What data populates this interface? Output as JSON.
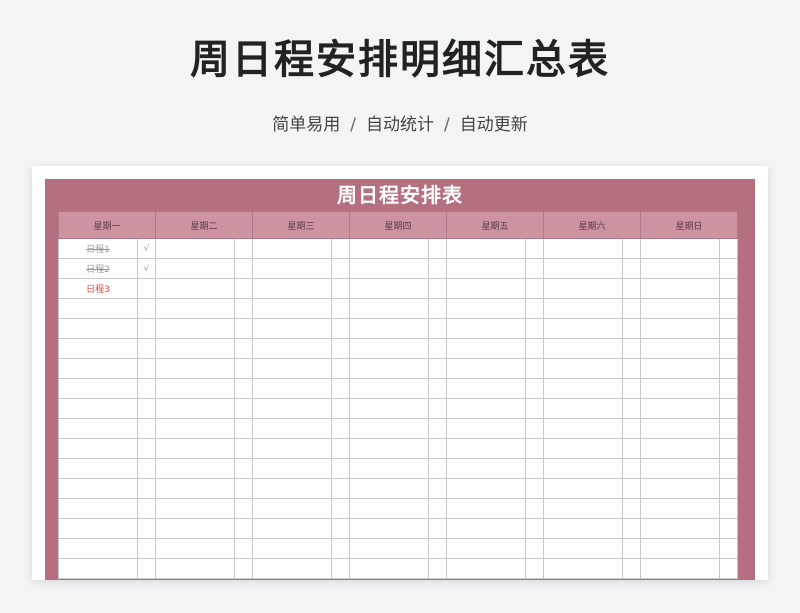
{
  "header": {
    "title": "周日程安排明细汇总表",
    "tags": [
      "简单易用",
      "自动统计",
      "自动更新"
    ],
    "separator": "/"
  },
  "sheet": {
    "title": "周日程安排表",
    "days": [
      "星期一",
      "星期二",
      "星期三",
      "星期四",
      "星期五",
      "星期六",
      "星期日"
    ],
    "monday_items": [
      {
        "label": "日程1",
        "mark": "√",
        "done": true
      },
      {
        "label": "日程2",
        "mark": "√",
        "done": true
      },
      {
        "label": "日程3",
        "mark": "",
        "done": false
      }
    ],
    "row_count": 17
  },
  "colors": {
    "sheet_bg": "#b57080",
    "header_cell": "#cd93a0",
    "done_text": "#9a9a9a",
    "pending_text": "#e04a3a"
  }
}
